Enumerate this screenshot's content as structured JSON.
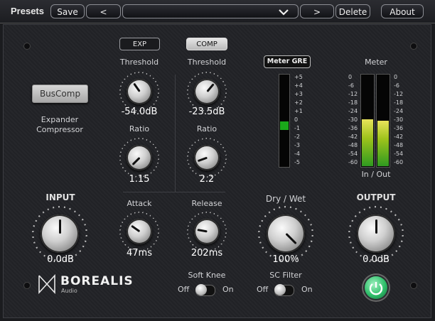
{
  "topbar": {
    "presets": "Presets",
    "save": "Save",
    "prev": "<",
    "preset_name": "",
    "dropdown_icon": "chevron-down-icon",
    "next": ">",
    "delete": "Delete",
    "about": "About"
  },
  "exp": {
    "label": "EXP",
    "threshold_label": "Threshold",
    "threshold": "-54.0dB",
    "ratio_label": "Ratio",
    "ratio": "1.15"
  },
  "comp": {
    "label": "COMP",
    "threshold_label": "Threshold",
    "threshold": "-23.5dB",
    "ratio_label": "Ratio",
    "ratio": "2.2"
  },
  "sidechain": {
    "buscomp": "BusComp",
    "mode_line1": "Expander",
    "mode_line2": "Compressor"
  },
  "gre": {
    "label": "Meter GRE",
    "scale": [
      "+5",
      "+4",
      "+3",
      "+2",
      "+1",
      "0",
      "-1",
      "-2",
      "-3",
      "-4",
      "-5"
    ],
    "level_db": 0
  },
  "meter": {
    "label": "Meter",
    "scale": [
      "0",
      "-6",
      "-12",
      "-18",
      "-24",
      "-30",
      "-36",
      "-42",
      "-48",
      "-54",
      "-60"
    ],
    "io_label": "In / Out",
    "in_level_pct": 51,
    "out_level_pct": 49
  },
  "input": {
    "label": "INPUT",
    "value": "0.0dB"
  },
  "attack": {
    "label": "Attack",
    "value": "47ms"
  },
  "release": {
    "label": "Release",
    "value": "202ms"
  },
  "drywet": {
    "label": "Dry / Wet",
    "value": "100%"
  },
  "output": {
    "label": "OUTPUT",
    "value": "0.0dB"
  },
  "softknee": {
    "label": "Soft Knee",
    "off": "Off",
    "on": "On"
  },
  "scfilter": {
    "label": "SC Filter",
    "off": "Off",
    "on": "On"
  },
  "brand": {
    "name": "BOREALIS",
    "sub": "Audio"
  },
  "colors": {
    "meter_green": "#1aa81a",
    "power_green": "#2fbf6a",
    "accent": "#ffffff"
  }
}
